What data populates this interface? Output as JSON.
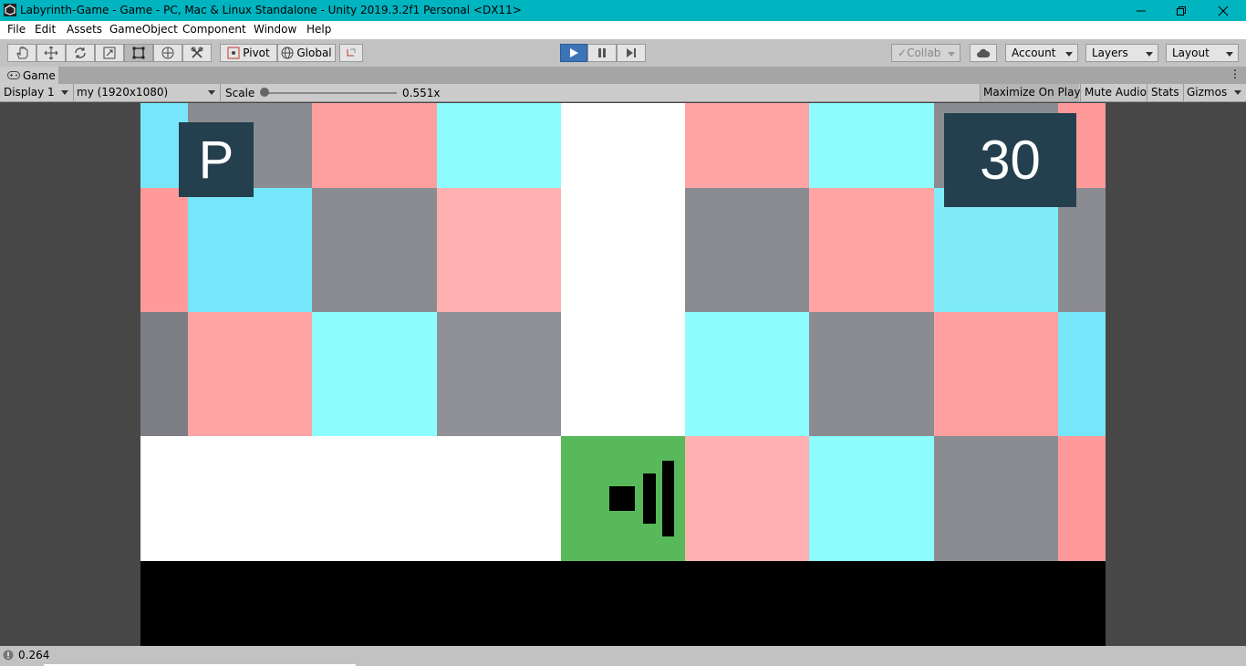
{
  "window": {
    "title": "Labyrinth-Game - Game - PC, Mac & Linux Standalone - Unity 2019.3.2f1 Personal <DX11>",
    "app_icon": "unity-icon",
    "controls": [
      "minimize-icon",
      "restore-icon",
      "close-icon"
    ]
  },
  "menu": {
    "items": [
      "File",
      "Edit",
      "Assets",
      "GameObject",
      "Component",
      "Window",
      "Help"
    ]
  },
  "toolbar": {
    "tools": [
      "hand-tool-icon",
      "move-tool-icon",
      "rotate-tool-icon",
      "scale-tool-icon",
      "rect-tool-icon",
      "transform-tool-icon",
      "custom-tool-icon"
    ],
    "pivot_label": "Pivot",
    "global_label": "Global",
    "play_icon": "play-icon",
    "pause_icon": "pause-icon",
    "step_icon": "step-icon",
    "collab_label": "Collab",
    "account_label": "Account",
    "layers_label": "Layers",
    "layout_label": "Layout"
  },
  "game_tab": {
    "tab_label": "Game",
    "display_select": "Display 1",
    "resolution_select": "my (1920x1080)",
    "scale_label": "Scale",
    "scale_value_text": "0.551x",
    "scale_value": 0.551,
    "maximize_label": "Maximize On Play",
    "mute_label": "Mute Audio",
    "stats_label": "Stats",
    "gizmos_label": "Gizmos"
  },
  "game": {
    "pause_button_label": "P",
    "timer_value": "30",
    "sound_icon": "volume-icon",
    "colors": {
      "cyan": "#8cfcfc",
      "blue": "#78e6fa",
      "pink": "#ffaaaa",
      "gray": "#8a8c92",
      "white": "#ffffff",
      "green": "#58b95a",
      "panel": "#24404e"
    }
  },
  "status": {
    "value": "0.264",
    "icon": "info-icon"
  }
}
